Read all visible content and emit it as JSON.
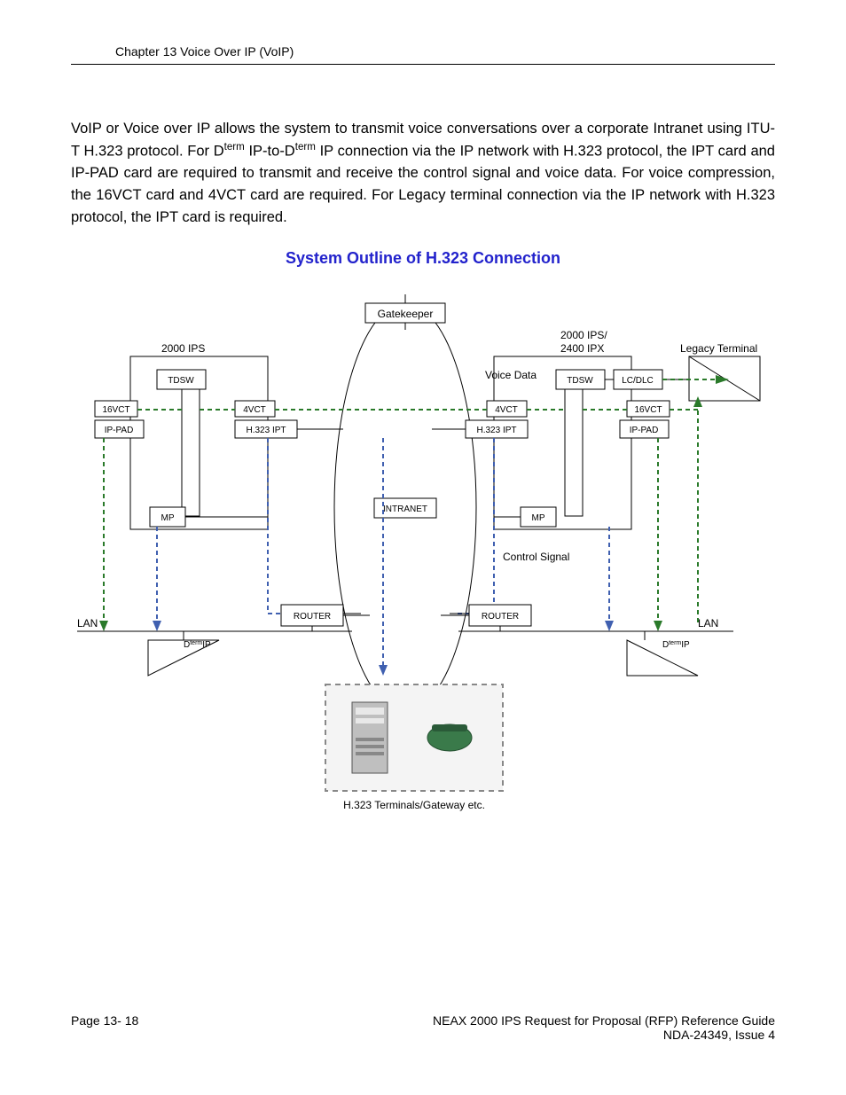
{
  "header": {
    "chapter": "Chapter 13 Voice Over IP (VoIP)"
  },
  "body": {
    "p1a": "VoIP or Voice over IP allows the system to transmit voice conversations over a corporate Intranet using ITU-T H.323 protocol.  For D",
    "p1b": " IP-to-D",
    "p1c": " IP connection via the IP network with H.323 protocol, the IPT card and IP-PAD card are required to transmit and receive the control signal and voice data. For voice compression, the 16VCT card and 4VCT card are required. For Legacy terminal connection via the IP network with H.323 protocol, the IPT card is required.",
    "sup": "term"
  },
  "diagram": {
    "title": "System Outline of H.323 Connection",
    "labels": {
      "gatekeeper": "Gatekeeper",
      "ips2000": "2000 IPS",
      "ips2400": "2000 IPS/\n2400 IPX",
      "legacy": "Legacy Terminal",
      "tdsw": "TDSW",
      "lcdlc": "LC/DLC",
      "vct16": "16VCT",
      "vct4": "4VCT",
      "ippad": "IP-PAD",
      "h323ipt": "H.323 IPT",
      "intranet": "INTRANET",
      "mp": "MP",
      "voicedata": "Voice Data",
      "controlsignal": "Control Signal",
      "lan": "LAN",
      "router": "ROUTER",
      "dtermip": "DtermIP",
      "caption": "H.323 Terminals/Gateway etc."
    }
  },
  "footer": {
    "page": "Page 13- 18",
    "doc1": "NEAX 2000 IPS Request for Proposal (RFP) Reference Guide",
    "doc2": "NDA-24349, Issue 4"
  }
}
